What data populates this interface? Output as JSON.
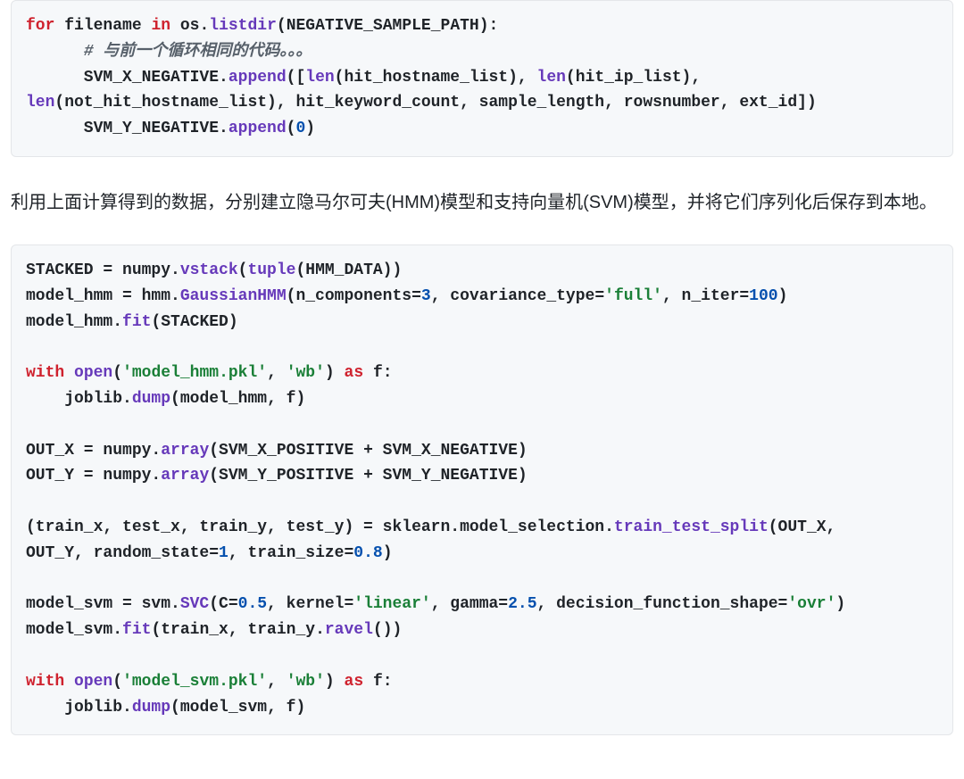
{
  "block1": {
    "t_for": "for",
    "t_in": "in",
    "t_filename": " filename ",
    "t_osdot": " os.",
    "fn_listdir": "listdir",
    "t_listdir_args": "(NEGATIVE_SAMPLE_PATH):",
    "indent1": "      ",
    "cmt_zh": "# 与前一个循环相同的代码。。。",
    "line3_pre": "      SVM_X_NEGATIVE.",
    "fn_append1": "append",
    "line3_open": "([",
    "fn_len1": "len",
    "line3_a1": "(hit_hostname_list), ",
    "fn_len2": "len",
    "line3_a2": "(hit_ip_list), ",
    "line4_pre": "",
    "fn_len3": "len",
    "line4_rest": "(not_hit_hostname_list), hit_keyword_count, sample_length, rowsnumber, ext_id])",
    "line5_pre": "      SVM_Y_NEGATIVE.",
    "fn_append2": "append",
    "line5_open": "(",
    "num0": "0",
    "line5_close": ")"
  },
  "prose": "利用上面计算得到的数据，分别建立隐马尔可夫(HMM)模型和支持向量机(SVM)模型，并将它们序列化后保存到本地。",
  "block2": {
    "l1_a": "STACKED = numpy.",
    "fn_vstack": "vstack",
    "l1_b": "(",
    "fn_tuple": "tuple",
    "l1_c": "(HMM_DATA))",
    "l2_a": "model_hmm = hmm.",
    "fn_gaussian": "GaussianHMM",
    "l2_b": "(n_components=",
    "num3": "3",
    "l2_c": ", covariance_type=",
    "str_full": "'full'",
    "l2_d": ", n_iter=",
    "num100": "100",
    "l2_e": ")",
    "l3_a": "model_hmm.",
    "fn_fit1": "fit",
    "l3_b": "(STACKED)",
    "l5_kw_with": "with",
    "l5_sp": " ",
    "fn_open1": "open",
    "l5_a": "(",
    "str_mhmm": "'model_hmm.pkl'",
    "l5_b": ", ",
    "str_wb1": "'wb'",
    "l5_c": ") ",
    "l5_kw_as": "as",
    "l5_d": " f:",
    "l6_a": "    joblib.",
    "fn_dump1": "dump",
    "l6_b": "(model_hmm, f)",
    "l8_a": "OUT_X = numpy.",
    "fn_array1": "array",
    "l8_b": "(SVM_X_POSITIVE + SVM_X_NEGATIVE)",
    "l9_a": "OUT_Y = numpy.",
    "fn_array2": "array",
    "l9_b": "(SVM_Y_POSITIVE + SVM_Y_NEGATIVE)",
    "l11_a": "(train_x, test_x, train_y, test_y) = sklearn.model_selection.",
    "fn_tts": "train_test_split",
    "l11_b": "(OUT_X, ",
    "l12_a": "OUT_Y, random_state=",
    "num1": "1",
    "l12_b": ", train_size=",
    "num08": "0.8",
    "l12_c": ")",
    "l14_a": "model_svm = svm.",
    "fn_svc": "SVC",
    "l14_b": "(C=",
    "num05": "0.5",
    "l14_c": ", kernel=",
    "str_linear": "'linear'",
    "l14_d": ", gamma=",
    "num25": "2.5",
    "l14_e": ", decision_function_shape=",
    "str_ovr": "'ovr'",
    "l14_f": ")",
    "l15_a": "model_svm.",
    "fn_fit2": "fit",
    "l15_b": "(train_x, train_y.",
    "fn_ravel": "ravel",
    "l15_c": "())",
    "l17_kw_with": "with",
    "fn_open2": "open",
    "l17_a": "(",
    "str_msvm": "'model_svm.pkl'",
    "l17_b": ", ",
    "str_wb2": "'wb'",
    "l17_c": ") ",
    "l17_kw_as": "as",
    "l17_d": " f:",
    "l18_a": "    joblib.",
    "fn_dump2": "dump",
    "l18_b": "(model_svm, f)"
  }
}
